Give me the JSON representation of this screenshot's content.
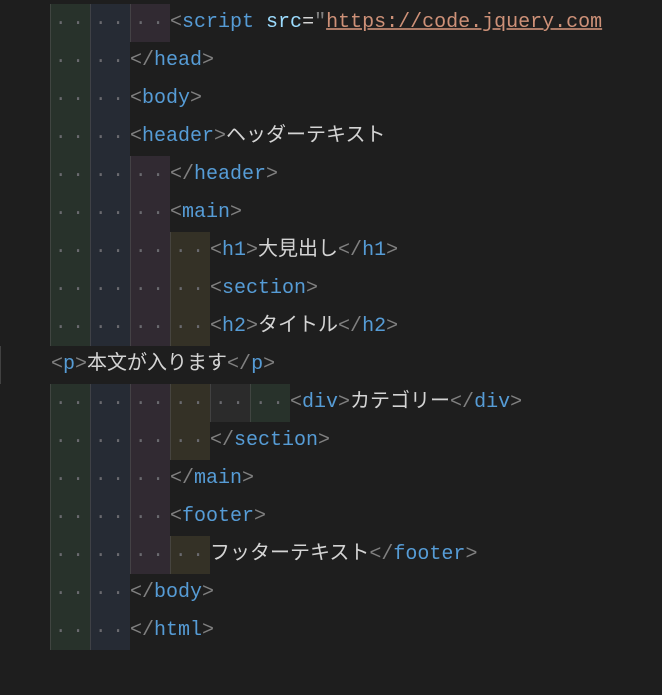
{
  "code": {
    "lines": [
      {
        "indent": [
          "g0",
          "g1",
          "g2"
        ],
        "segments": [
          {
            "cls": "br",
            "t": "<"
          },
          {
            "cls": "tag",
            "t": "script"
          },
          {
            "cls": "txt",
            "t": " "
          },
          {
            "cls": "attr",
            "t": "src"
          },
          {
            "cls": "eq",
            "t": "="
          },
          {
            "cls": "br",
            "t": "\""
          },
          {
            "cls": "str",
            "t": "https://code.jquery.com"
          }
        ]
      },
      {
        "indent": [
          "g0",
          "g1"
        ],
        "segments": [
          {
            "cls": "br",
            "t": "</"
          },
          {
            "cls": "tag",
            "t": "head"
          },
          {
            "cls": "br",
            "t": ">"
          }
        ]
      },
      {
        "indent": [
          "g0",
          "g1"
        ],
        "segments": [
          {
            "cls": "br",
            "t": "<"
          },
          {
            "cls": "tag",
            "t": "body"
          },
          {
            "cls": "br",
            "t": ">"
          }
        ]
      },
      {
        "indent": [
          "g0",
          "g1"
        ],
        "segments": [
          {
            "cls": "br",
            "t": "<"
          },
          {
            "cls": "tag",
            "t": "header"
          },
          {
            "cls": "br",
            "t": ">"
          },
          {
            "cls": "txt",
            "t": "ヘッダーテキスト"
          }
        ]
      },
      {
        "indent": [
          "g0",
          "g1",
          "g2"
        ],
        "segments": [
          {
            "cls": "br",
            "t": "</"
          },
          {
            "cls": "tag",
            "t": "header"
          },
          {
            "cls": "br",
            "t": ">"
          }
        ]
      },
      {
        "indent": [
          "g0",
          "g1",
          "g2"
        ],
        "segments": [
          {
            "cls": "br",
            "t": "<"
          },
          {
            "cls": "tag",
            "t": "main"
          },
          {
            "cls": "br",
            "t": ">"
          }
        ]
      },
      {
        "indent": [
          "g0",
          "g1",
          "g2",
          "g3"
        ],
        "segments": [
          {
            "cls": "br",
            "t": "<"
          },
          {
            "cls": "tag",
            "t": "h1"
          },
          {
            "cls": "br",
            "t": ">"
          },
          {
            "cls": "txt",
            "t": "大見出し"
          },
          {
            "cls": "br",
            "t": "</"
          },
          {
            "cls": "tag",
            "t": "h1"
          },
          {
            "cls": "br",
            "t": ">"
          }
        ]
      },
      {
        "indent": [
          "g0",
          "g1",
          "g2",
          "g3"
        ],
        "segments": [
          {
            "cls": "br",
            "t": "<"
          },
          {
            "cls": "tag",
            "t": "section"
          },
          {
            "cls": "br",
            "t": ">"
          }
        ]
      },
      {
        "indent": [
          "g0",
          "g1",
          "g2",
          "g3"
        ],
        "segments": [
          {
            "cls": "br",
            "t": "<"
          },
          {
            "cls": "tag",
            "t": "h2"
          },
          {
            "cls": "br",
            "t": ">"
          },
          {
            "cls": "txt",
            "t": "タイトル"
          },
          {
            "cls": "br",
            "t": "</"
          },
          {
            "cls": "tag",
            "t": "h2"
          },
          {
            "cls": "br",
            "t": ">"
          }
        ]
      },
      {
        "indent": [],
        "lead": true,
        "segments": [
          {
            "cls": "br",
            "t": "<"
          },
          {
            "cls": "tag",
            "t": "p"
          },
          {
            "cls": "br",
            "t": ">"
          },
          {
            "cls": "txt",
            "t": "本文が入ります"
          },
          {
            "cls": "br",
            "t": "</"
          },
          {
            "cls": "tag",
            "t": "p"
          },
          {
            "cls": "br",
            "t": ">"
          }
        ]
      },
      {
        "indent": [
          "g0",
          "g1",
          "g2",
          "g3",
          "g4",
          "g0"
        ],
        "segments": [
          {
            "cls": "br",
            "t": "<"
          },
          {
            "cls": "tag",
            "t": "div"
          },
          {
            "cls": "br",
            "t": ">"
          },
          {
            "cls": "txt",
            "t": "カテゴリー"
          },
          {
            "cls": "br",
            "t": "</"
          },
          {
            "cls": "tag",
            "t": "div"
          },
          {
            "cls": "br",
            "t": ">"
          }
        ]
      },
      {
        "indent": [
          "g0",
          "g1",
          "g2",
          "g3"
        ],
        "segments": [
          {
            "cls": "br",
            "t": "</"
          },
          {
            "cls": "tag",
            "t": "section"
          },
          {
            "cls": "br",
            "t": ">"
          }
        ]
      },
      {
        "indent": [
          "g0",
          "g1",
          "g2"
        ],
        "segments": [
          {
            "cls": "br",
            "t": "</"
          },
          {
            "cls": "tag",
            "t": "main"
          },
          {
            "cls": "br",
            "t": ">"
          }
        ]
      },
      {
        "indent": [
          "g0",
          "g1",
          "g2"
        ],
        "segments": [
          {
            "cls": "br",
            "t": "<"
          },
          {
            "cls": "tag",
            "t": "footer"
          },
          {
            "cls": "br",
            "t": ">"
          }
        ]
      },
      {
        "indent": [
          "g0",
          "g1",
          "g2",
          "g3"
        ],
        "segments": [
          {
            "cls": "txt",
            "t": "フッターテキスト"
          },
          {
            "cls": "br",
            "t": "</"
          },
          {
            "cls": "tag",
            "t": "footer"
          },
          {
            "cls": "br",
            "t": ">"
          }
        ]
      },
      {
        "indent": [
          "g0",
          "g1"
        ],
        "segments": [
          {
            "cls": "br",
            "t": "</"
          },
          {
            "cls": "tag",
            "t": "body"
          },
          {
            "cls": "br",
            "t": ">"
          }
        ]
      },
      {
        "indent": [
          "g0",
          "g1"
        ],
        "segments": [
          {
            "cls": "br",
            "t": "</"
          },
          {
            "cls": "tag",
            "t": "html"
          },
          {
            "cls": "br",
            "t": ">"
          }
        ]
      }
    ]
  }
}
